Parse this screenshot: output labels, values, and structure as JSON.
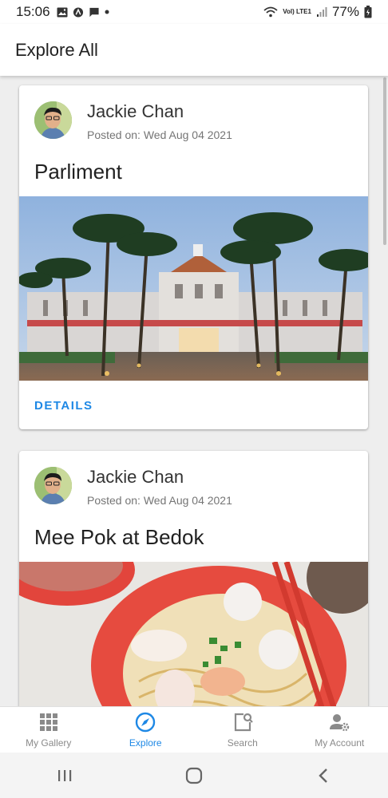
{
  "status_bar": {
    "time": "15:06",
    "battery": "77%",
    "network": "Vol) LTE1"
  },
  "app_bar": {
    "title": "Explore All"
  },
  "posts": [
    {
      "author": "Jackie Chan",
      "posted": "Posted on: Wed Aug 04 2021",
      "title": "Parliment",
      "action": "DETAILS"
    },
    {
      "author": "Jackie Chan",
      "posted": "Posted on: Wed Aug 04 2021",
      "title": "Mee Pok at Bedok"
    }
  ],
  "bottom_nav": {
    "items": [
      {
        "label": "My Gallery",
        "icon": "grid-icon"
      },
      {
        "label": "Explore",
        "icon": "compass-icon",
        "active": true
      },
      {
        "label": "Search",
        "icon": "search-document-icon"
      },
      {
        "label": "My Account",
        "icon": "account-settings-icon"
      }
    ]
  },
  "colors": {
    "accent": "#1e88e5",
    "inactive": "#8a8a8a"
  }
}
